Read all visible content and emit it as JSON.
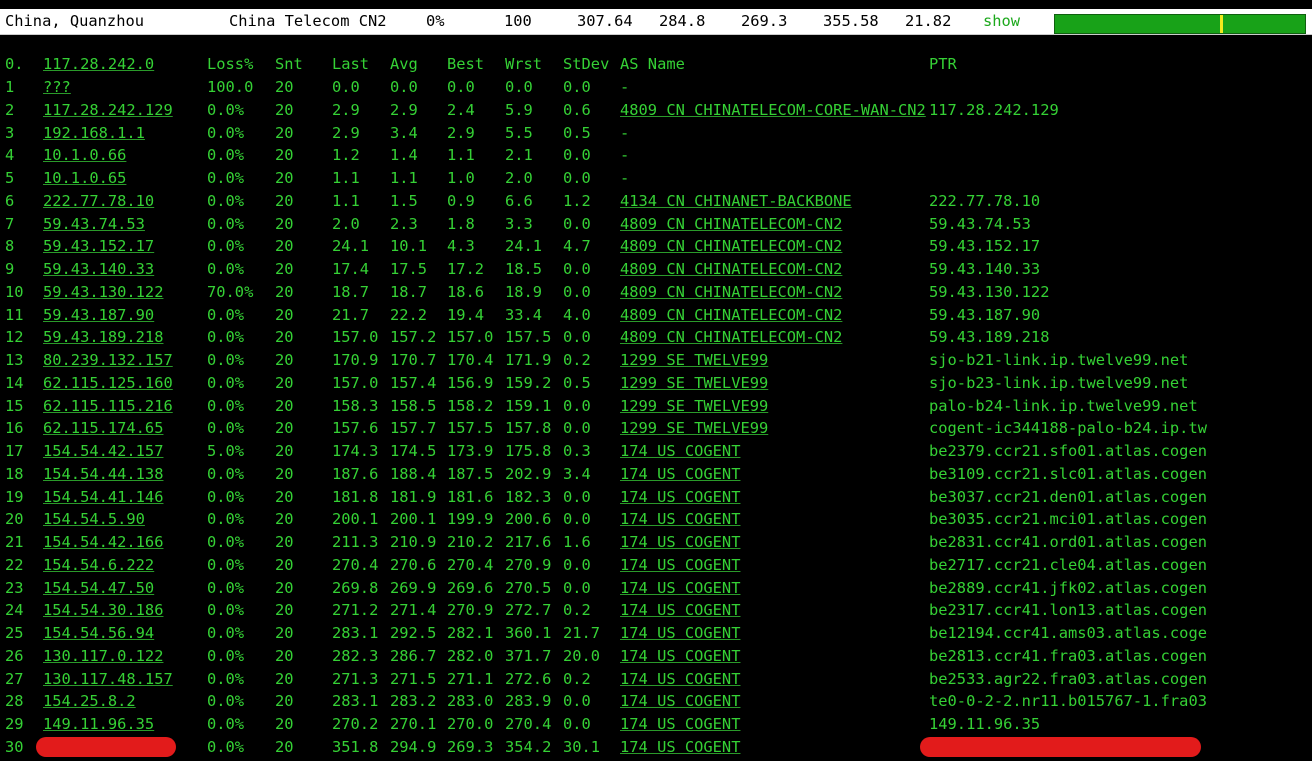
{
  "summary": {
    "location": "China, Quanzhou",
    "isp": "China Telecom CN2",
    "loss": "0%",
    "sent": "100",
    "last": "307.64",
    "avg": "284.8",
    "best": "269.3",
    "worst": "355.58",
    "stdev": "21.82",
    "show_label": "show"
  },
  "headers": {
    "num": "0.",
    "host": "117.28.242.0",
    "loss": "Loss%",
    "snt": "Snt",
    "last": "Last",
    "avg": "Avg",
    "best": "Best",
    "wrst": "Wrst",
    "stdev": "StDev",
    "asname": "AS Name",
    "ptr": "PTR"
  },
  "rows": [
    {
      "num": "1",
      "host": "???",
      "loss": "100.0",
      "snt": "20",
      "last": "0.0",
      "avg": "0.0",
      "best": "0.0",
      "wrst": "0.0",
      "stdev": "0.0",
      "as": "-",
      "asname": "",
      "ptr": ""
    },
    {
      "num": "2",
      "host": "117.28.242.129",
      "loss": "0.0%",
      "snt": "20",
      "last": "2.9",
      "avg": "2.9",
      "best": "2.4",
      "wrst": "5.9",
      "stdev": "0.6",
      "as": "4809  CN CHINATELECOM-CORE-WAN-CN2",
      "asname": "",
      "ptr": "117.28.242.129"
    },
    {
      "num": "3",
      "host": "192.168.1.1",
      "loss": "0.0%",
      "snt": "20",
      "last": "2.9",
      "avg": "3.4",
      "best": "2.9",
      "wrst": "5.5",
      "stdev": "0.5",
      "as": "-",
      "asname": "",
      "ptr": ""
    },
    {
      "num": "4",
      "host": "10.1.0.66",
      "loss": "0.0%",
      "snt": "20",
      "last": "1.2",
      "avg": "1.4",
      "best": "1.1",
      "wrst": "2.1",
      "stdev": "0.0",
      "as": "-",
      "asname": "",
      "ptr": ""
    },
    {
      "num": "5",
      "host": "10.1.0.65",
      "loss": "0.0%",
      "snt": "20",
      "last": "1.1",
      "avg": "1.1",
      "best": "1.0",
      "wrst": "2.0",
      "stdev": "0.0",
      "as": "-",
      "asname": "",
      "ptr": ""
    },
    {
      "num": "6",
      "host": "222.77.78.10",
      "loss": "0.0%",
      "snt": "20",
      "last": "1.1",
      "avg": "1.5",
      "best": "0.9",
      "wrst": "6.6",
      "stdev": "1.2",
      "as": "4134  CN CHINANET-BACKBONE",
      "asname": "",
      "ptr": "222.77.78.10"
    },
    {
      "num": "7",
      "host": "59.43.74.53",
      "loss": "0.0%",
      "snt": "20",
      "last": "2.0",
      "avg": "2.3",
      "best": "1.8",
      "wrst": "3.3",
      "stdev": "0.0",
      "as": "4809  CN CHINATELECOM-CN2",
      "asname": "",
      "ptr": "59.43.74.53"
    },
    {
      "num": "8",
      "host": "59.43.152.17",
      "loss": "0.0%",
      "snt": "20",
      "last": "24.1",
      "avg": "10.1",
      "best": "4.3",
      "wrst": "24.1",
      "stdev": "4.7",
      "as": "4809  CN CHINATELECOM-CN2",
      "asname": "",
      "ptr": "59.43.152.17"
    },
    {
      "num": "9",
      "host": "59.43.140.33",
      "loss": "0.0%",
      "snt": "20",
      "last": "17.4",
      "avg": "17.5",
      "best": "17.2",
      "wrst": "18.5",
      "stdev": "0.0",
      "as": "4809  CN CHINATELECOM-CN2",
      "asname": "",
      "ptr": "59.43.140.33"
    },
    {
      "num": "10",
      "host": "59.43.130.122",
      "loss": "70.0%",
      "snt": "20",
      "last": "18.7",
      "avg": "18.7",
      "best": "18.6",
      "wrst": "18.9",
      "stdev": "0.0",
      "as": "4809  CN CHINATELECOM-CN2",
      "asname": "",
      "ptr": "59.43.130.122"
    },
    {
      "num": "11",
      "host": "59.43.187.90",
      "loss": "0.0%",
      "snt": "20",
      "last": "21.7",
      "avg": "22.2",
      "best": "19.4",
      "wrst": "33.4",
      "stdev": "4.0",
      "as": "4809  CN CHINATELECOM-CN2",
      "asname": "",
      "ptr": "59.43.187.90"
    },
    {
      "num": "12",
      "host": "59.43.189.218",
      "loss": "0.0%",
      "snt": "20",
      "last": "157.0",
      "avg": "157.2",
      "best": "157.0",
      "wrst": "157.5",
      "stdev": "0.0",
      "as": "4809  CN CHINATELECOM-CN2",
      "asname": "",
      "ptr": "59.43.189.218"
    },
    {
      "num": "13",
      "host": "80.239.132.157",
      "loss": "0.0%",
      "snt": "20",
      "last": "170.9",
      "avg": "170.7",
      "best": "170.4",
      "wrst": "171.9",
      "stdev": "0.2",
      "as": "1299  SE TWELVE99",
      "asname": "",
      "ptr": "sjo-b21-link.ip.twelve99.net"
    },
    {
      "num": "14",
      "host": "62.115.125.160",
      "loss": "0.0%",
      "snt": "20",
      "last": "157.0",
      "avg": "157.4",
      "best": "156.9",
      "wrst": "159.2",
      "stdev": "0.5",
      "as": "1299  SE TWELVE99",
      "asname": "",
      "ptr": "sjo-b23-link.ip.twelve99.net"
    },
    {
      "num": "15",
      "host": "62.115.115.216",
      "loss": "0.0%",
      "snt": "20",
      "last": "158.3",
      "avg": "158.5",
      "best": "158.2",
      "wrst": "159.1",
      "stdev": "0.0",
      "as": "1299  SE TWELVE99",
      "asname": "",
      "ptr": "palo-b24-link.ip.twelve99.net"
    },
    {
      "num": "16",
      "host": "62.115.174.65",
      "loss": "0.0%",
      "snt": "20",
      "last": "157.6",
      "avg": "157.7",
      "best": "157.5",
      "wrst": "157.8",
      "stdev": "0.0",
      "as": "1299  SE TWELVE99",
      "asname": "",
      "ptr": "cogent-ic344188-palo-b24.ip.tw"
    },
    {
      "num": "17",
      "host": "154.54.42.157",
      "loss": "5.0%",
      "snt": "20",
      "last": "174.3",
      "avg": "174.5",
      "best": "173.9",
      "wrst": "175.8",
      "stdev": "0.3",
      "as": "174   US COGENT",
      "asname": "",
      "ptr": "be2379.ccr21.sfo01.atlas.cogen"
    },
    {
      "num": "18",
      "host": "154.54.44.138",
      "loss": "0.0%",
      "snt": "20",
      "last": "187.6",
      "avg": "188.4",
      "best": "187.5",
      "wrst": "202.9",
      "stdev": "3.4",
      "as": "174   US COGENT",
      "asname": "",
      "ptr": "be3109.ccr21.slc01.atlas.cogen"
    },
    {
      "num": "19",
      "host": "154.54.41.146",
      "loss": "0.0%",
      "snt": "20",
      "last": "181.8",
      "avg": "181.9",
      "best": "181.6",
      "wrst": "182.3",
      "stdev": "0.0",
      "as": "174   US COGENT",
      "asname": "",
      "ptr": "be3037.ccr21.den01.atlas.cogen"
    },
    {
      "num": "20",
      "host": "154.54.5.90",
      "loss": "0.0%",
      "snt": "20",
      "last": "200.1",
      "avg": "200.1",
      "best": "199.9",
      "wrst": "200.6",
      "stdev": "0.0",
      "as": "174   US COGENT",
      "asname": "",
      "ptr": "be3035.ccr21.mci01.atlas.cogen"
    },
    {
      "num": "21",
      "host": "154.54.42.166",
      "loss": "0.0%",
      "snt": "20",
      "last": "211.3",
      "avg": "210.9",
      "best": "210.2",
      "wrst": "217.6",
      "stdev": "1.6",
      "as": "174   US COGENT",
      "asname": "",
      "ptr": "be2831.ccr41.ord01.atlas.cogen"
    },
    {
      "num": "22",
      "host": "154.54.6.222",
      "loss": "0.0%",
      "snt": "20",
      "last": "270.4",
      "avg": "270.6",
      "best": "270.4",
      "wrst": "270.9",
      "stdev": "0.0",
      "as": "174   US COGENT",
      "asname": "",
      "ptr": "be2717.ccr21.cle04.atlas.cogen"
    },
    {
      "num": "23",
      "host": "154.54.47.50",
      "loss": "0.0%",
      "snt": "20",
      "last": "269.8",
      "avg": "269.9",
      "best": "269.6",
      "wrst": "270.5",
      "stdev": "0.0",
      "as": "174   US COGENT",
      "asname": "",
      "ptr": "be2889.ccr41.jfk02.atlas.cogen"
    },
    {
      "num": "24",
      "host": "154.54.30.186",
      "loss": "0.0%",
      "snt": "20",
      "last": "271.2",
      "avg": "271.4",
      "best": "270.9",
      "wrst": "272.7",
      "stdev": "0.2",
      "as": "174   US COGENT",
      "asname": "",
      "ptr": "be2317.ccr41.lon13.atlas.cogen"
    },
    {
      "num": "25",
      "host": "154.54.56.94",
      "loss": "0.0%",
      "snt": "20",
      "last": "283.1",
      "avg": "292.5",
      "best": "282.1",
      "wrst": "360.1",
      "stdev": "21.7",
      "as": "174   US COGENT",
      "asname": "",
      "ptr": "be12194.ccr41.ams03.atlas.coge"
    },
    {
      "num": "26",
      "host": "130.117.0.122",
      "loss": "0.0%",
      "snt": "20",
      "last": "282.3",
      "avg": "286.7",
      "best": "282.0",
      "wrst": "371.7",
      "stdev": "20.0",
      "as": "174   US COGENT",
      "asname": "",
      "ptr": "be2813.ccr41.fra03.atlas.cogen"
    },
    {
      "num": "27",
      "host": "130.117.48.157",
      "loss": "0.0%",
      "snt": "20",
      "last": "271.3",
      "avg": "271.5",
      "best": "271.1",
      "wrst": "272.6",
      "stdev": "0.2",
      "as": "174   US COGENT",
      "asname": "",
      "ptr": "be2533.agr22.fra03.atlas.cogen"
    },
    {
      "num": "28",
      "host": "154.25.8.2",
      "loss": "0.0%",
      "snt": "20",
      "last": "283.1",
      "avg": "283.2",
      "best": "283.0",
      "wrst": "283.9",
      "stdev": "0.0",
      "as": "174   US COGENT",
      "asname": "",
      "ptr": "te0-0-2-2.nr11.b015767-1.fra03"
    },
    {
      "num": "29",
      "host": "149.11.96.35",
      "loss": "0.0%",
      "snt": "20",
      "last": "270.2",
      "avg": "270.1",
      "best": "270.0",
      "wrst": "270.4",
      "stdev": "0.0",
      "as": "174   US COGENT",
      "asname": "",
      "ptr": "149.11.96.35"
    },
    {
      "num": "30",
      "host": "",
      "loss": "0.0%",
      "snt": "20",
      "last": "351.8",
      "avg": "294.9",
      "best": "269.3",
      "wrst": "354.2",
      "stdev": "30.1",
      "as": "174   US COGENT",
      "asname": "",
      "ptr": "",
      "redacted": true
    }
  ],
  "colors": {
    "text": "#35d135",
    "background": "#000000",
    "redaction": "#e21b1b",
    "bar": "#18a218",
    "bar_marker": "#f1ea1e"
  },
  "latency_bar": {
    "marker_fraction": 0.66
  }
}
